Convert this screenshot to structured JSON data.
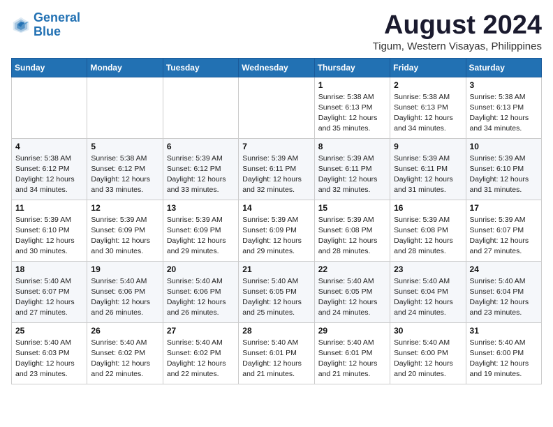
{
  "logo": {
    "line1": "General",
    "line2": "Blue"
  },
  "title": "August 2024",
  "location": "Tigum, Western Visayas, Philippines",
  "days_of_week": [
    "Sunday",
    "Monday",
    "Tuesday",
    "Wednesday",
    "Thursday",
    "Friday",
    "Saturday"
  ],
  "weeks": [
    [
      {
        "day": "",
        "info": ""
      },
      {
        "day": "",
        "info": ""
      },
      {
        "day": "",
        "info": ""
      },
      {
        "day": "",
        "info": ""
      },
      {
        "day": "1",
        "info": "Sunrise: 5:38 AM\nSunset: 6:13 PM\nDaylight: 12 hours\nand 35 minutes."
      },
      {
        "day": "2",
        "info": "Sunrise: 5:38 AM\nSunset: 6:13 PM\nDaylight: 12 hours\nand 34 minutes."
      },
      {
        "day": "3",
        "info": "Sunrise: 5:38 AM\nSunset: 6:13 PM\nDaylight: 12 hours\nand 34 minutes."
      }
    ],
    [
      {
        "day": "4",
        "info": "Sunrise: 5:38 AM\nSunset: 6:12 PM\nDaylight: 12 hours\nand 34 minutes."
      },
      {
        "day": "5",
        "info": "Sunrise: 5:38 AM\nSunset: 6:12 PM\nDaylight: 12 hours\nand 33 minutes."
      },
      {
        "day": "6",
        "info": "Sunrise: 5:39 AM\nSunset: 6:12 PM\nDaylight: 12 hours\nand 33 minutes."
      },
      {
        "day": "7",
        "info": "Sunrise: 5:39 AM\nSunset: 6:11 PM\nDaylight: 12 hours\nand 32 minutes."
      },
      {
        "day": "8",
        "info": "Sunrise: 5:39 AM\nSunset: 6:11 PM\nDaylight: 12 hours\nand 32 minutes."
      },
      {
        "day": "9",
        "info": "Sunrise: 5:39 AM\nSunset: 6:11 PM\nDaylight: 12 hours\nand 31 minutes."
      },
      {
        "day": "10",
        "info": "Sunrise: 5:39 AM\nSunset: 6:10 PM\nDaylight: 12 hours\nand 31 minutes."
      }
    ],
    [
      {
        "day": "11",
        "info": "Sunrise: 5:39 AM\nSunset: 6:10 PM\nDaylight: 12 hours\nand 30 minutes."
      },
      {
        "day": "12",
        "info": "Sunrise: 5:39 AM\nSunset: 6:09 PM\nDaylight: 12 hours\nand 30 minutes."
      },
      {
        "day": "13",
        "info": "Sunrise: 5:39 AM\nSunset: 6:09 PM\nDaylight: 12 hours\nand 29 minutes."
      },
      {
        "day": "14",
        "info": "Sunrise: 5:39 AM\nSunset: 6:09 PM\nDaylight: 12 hours\nand 29 minutes."
      },
      {
        "day": "15",
        "info": "Sunrise: 5:39 AM\nSunset: 6:08 PM\nDaylight: 12 hours\nand 28 minutes."
      },
      {
        "day": "16",
        "info": "Sunrise: 5:39 AM\nSunset: 6:08 PM\nDaylight: 12 hours\nand 28 minutes."
      },
      {
        "day": "17",
        "info": "Sunrise: 5:39 AM\nSunset: 6:07 PM\nDaylight: 12 hours\nand 27 minutes."
      }
    ],
    [
      {
        "day": "18",
        "info": "Sunrise: 5:40 AM\nSunset: 6:07 PM\nDaylight: 12 hours\nand 27 minutes."
      },
      {
        "day": "19",
        "info": "Sunrise: 5:40 AM\nSunset: 6:06 PM\nDaylight: 12 hours\nand 26 minutes."
      },
      {
        "day": "20",
        "info": "Sunrise: 5:40 AM\nSunset: 6:06 PM\nDaylight: 12 hours\nand 26 minutes."
      },
      {
        "day": "21",
        "info": "Sunrise: 5:40 AM\nSunset: 6:05 PM\nDaylight: 12 hours\nand 25 minutes."
      },
      {
        "day": "22",
        "info": "Sunrise: 5:40 AM\nSunset: 6:05 PM\nDaylight: 12 hours\nand 24 minutes."
      },
      {
        "day": "23",
        "info": "Sunrise: 5:40 AM\nSunset: 6:04 PM\nDaylight: 12 hours\nand 24 minutes."
      },
      {
        "day": "24",
        "info": "Sunrise: 5:40 AM\nSunset: 6:04 PM\nDaylight: 12 hours\nand 23 minutes."
      }
    ],
    [
      {
        "day": "25",
        "info": "Sunrise: 5:40 AM\nSunset: 6:03 PM\nDaylight: 12 hours\nand 23 minutes."
      },
      {
        "day": "26",
        "info": "Sunrise: 5:40 AM\nSunset: 6:02 PM\nDaylight: 12 hours\nand 22 minutes."
      },
      {
        "day": "27",
        "info": "Sunrise: 5:40 AM\nSunset: 6:02 PM\nDaylight: 12 hours\nand 22 minutes."
      },
      {
        "day": "28",
        "info": "Sunrise: 5:40 AM\nSunset: 6:01 PM\nDaylight: 12 hours\nand 21 minutes."
      },
      {
        "day": "29",
        "info": "Sunrise: 5:40 AM\nSunset: 6:01 PM\nDaylight: 12 hours\nand 21 minutes."
      },
      {
        "day": "30",
        "info": "Sunrise: 5:40 AM\nSunset: 6:00 PM\nDaylight: 12 hours\nand 20 minutes."
      },
      {
        "day": "31",
        "info": "Sunrise: 5:40 AM\nSunset: 6:00 PM\nDaylight: 12 hours\nand 19 minutes."
      }
    ]
  ]
}
